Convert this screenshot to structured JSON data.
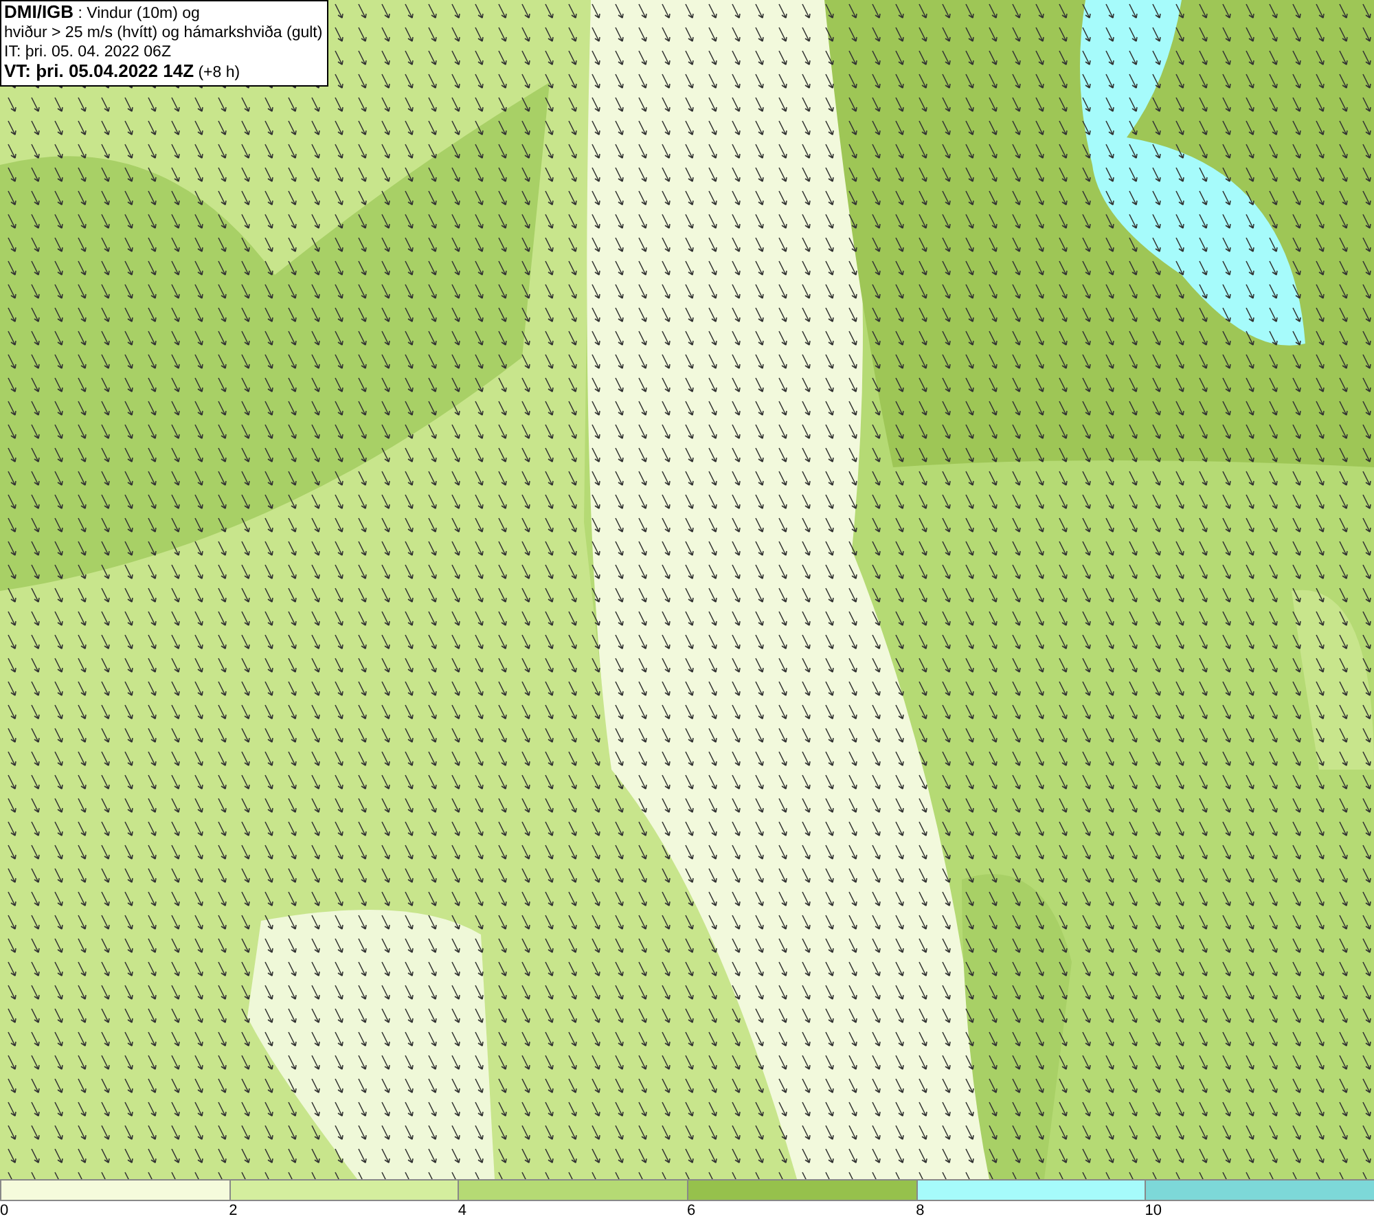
{
  "title_box": {
    "lines": [
      "**DMI/IGB** : Vindur (10m) og",
      "hviður > 25 m/s (hvítt) og hámarkshviða (gult)",
      "IT: þri. 05. 04. 2022 06Z",
      "**VT: þri. 05.04.2022 14Z** (+8 h)"
    ]
  },
  "legend": {
    "bins": [
      {
        "color": "#f5fbdc"
      },
      {
        "color": "#d4ee9e"
      },
      {
        "color": "#b5da74"
      },
      {
        "color": "#96c14c"
      },
      {
        "color": "#a6fbfb"
      },
      {
        "color": "#7dd8d8"
      }
    ],
    "ticks": [
      "0",
      "2",
      "4",
      "6",
      "8",
      "10"
    ]
  }
}
